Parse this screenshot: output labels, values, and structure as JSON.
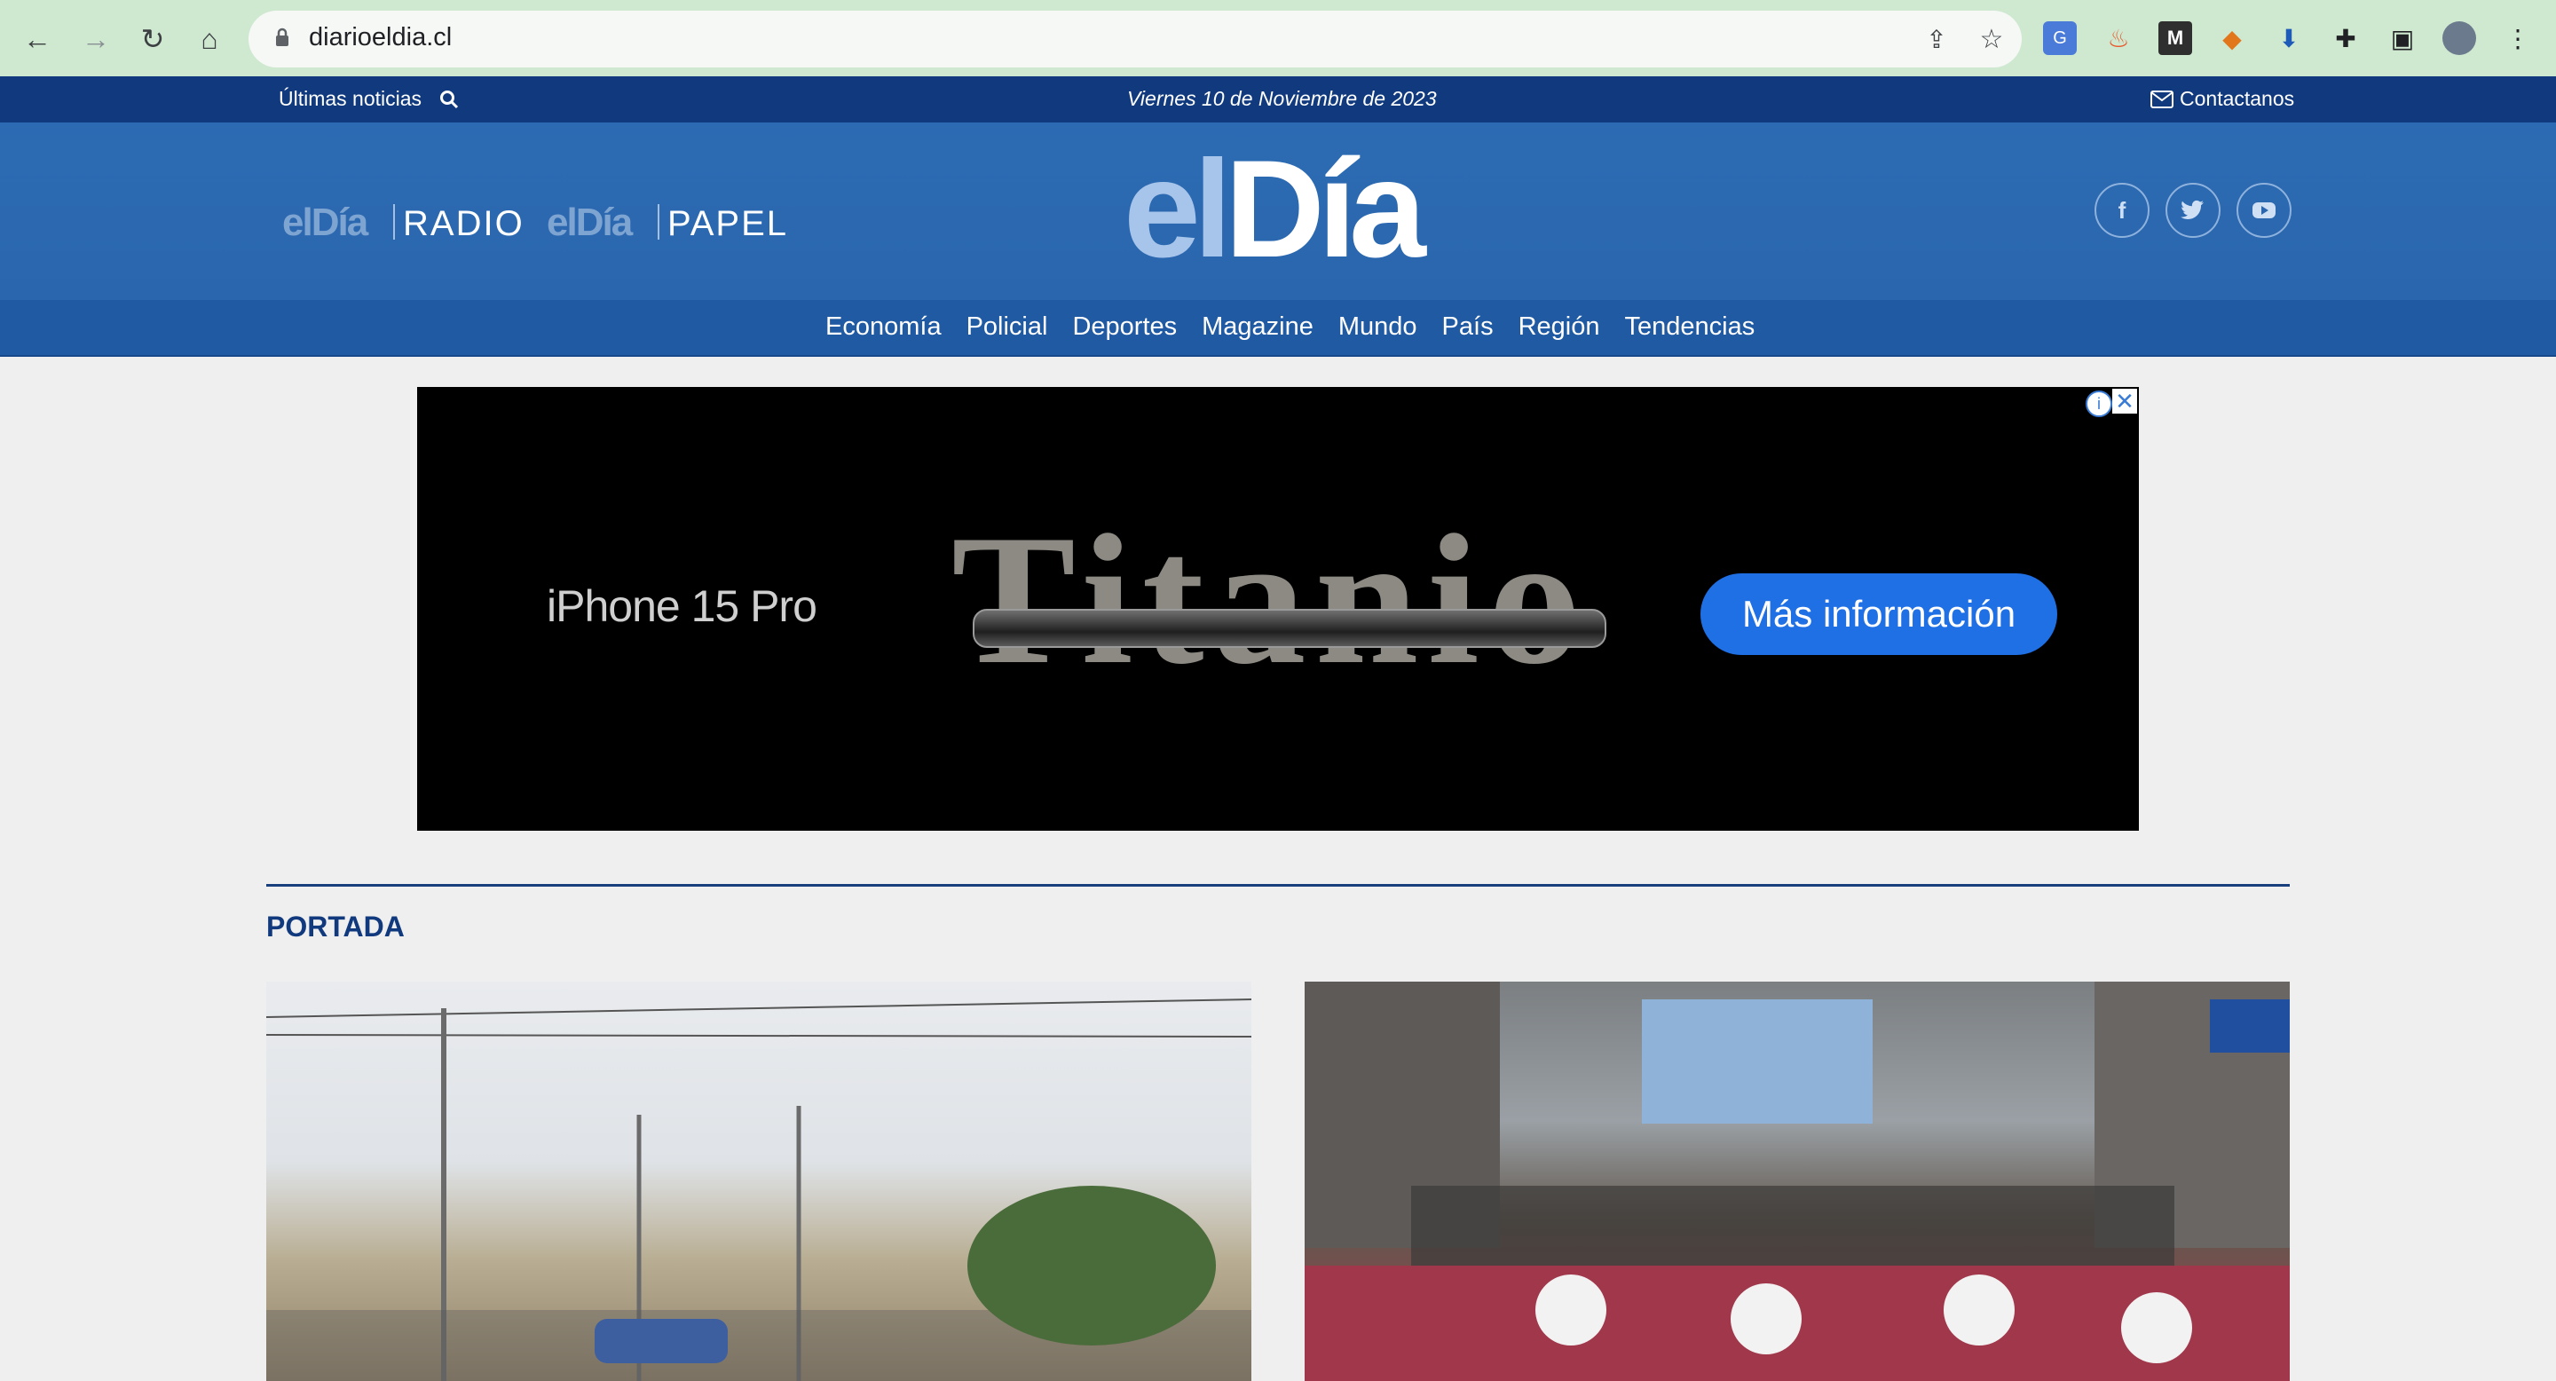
{
  "browser": {
    "url": "diarioeldia.cl",
    "icons": [
      "back-icon",
      "forward-icon",
      "reload-icon",
      "home-icon",
      "lock-icon",
      "share-icon",
      "star-icon",
      "translate-icon",
      "extension-icon",
      "puzzle-icon",
      "sidebar-icon",
      "profile-avatar",
      "menu-icon"
    ]
  },
  "topbar": {
    "latest": "Últimas noticias",
    "date": "Viernes 10 de Noviembre de  2023",
    "contact": "Contactanos"
  },
  "header": {
    "radio_el": "el",
    "radio_dia": "Día",
    "radio_label": "RADIO",
    "papel_el": "el",
    "papel_dia": "Día",
    "papel_label": "PAPEL",
    "logo_el": "el",
    "logo_dia": "Día"
  },
  "nav": {
    "items": [
      "Economía",
      "Policial",
      "Deportes",
      "Magazine",
      "Mundo",
      "País",
      "Región",
      "Tendencias"
    ]
  },
  "ad": {
    "product": "iPhone 15 Pro",
    "headline": "Titanio",
    "cta": "Más información",
    "info_icon": "i",
    "close_icon": "✕"
  },
  "section": {
    "title": "PORTADA"
  },
  "colors": {
    "brand_dark": "#113a7e",
    "brand": "#2a66ae",
    "cta": "#1f6fe5"
  }
}
